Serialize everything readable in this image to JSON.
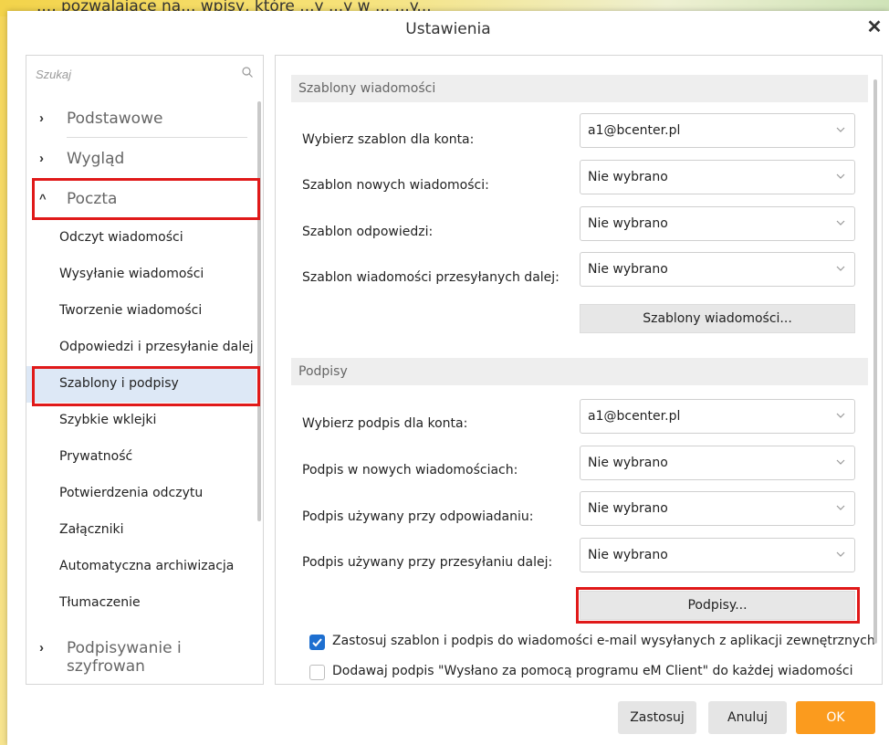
{
  "background": {
    "partial_text": "..., pozwalające na... wpisy, które ...y ...y w ... ...y..."
  },
  "dialog": {
    "title": "Ustawienia"
  },
  "sidebar": {
    "search_placeholder": "Szukaj",
    "categories": [
      {
        "label": "Podstawowe",
        "expanded": false
      },
      {
        "label": "Wygląd",
        "expanded": false
      },
      {
        "label": "Poczta",
        "expanded": true
      }
    ],
    "mail_items": [
      "Odczyt wiadomości",
      "Wysyłanie wiadomości",
      "Tworzenie wiadomości",
      "Odpowiedzi i przesyłanie dalej",
      "Szablony i podpisy",
      "Szybkie wklejki",
      "Prywatność",
      "Potwierdzenia odczytu",
      "Załączniki",
      "Automatyczna archiwizacja",
      "Tłumaczenie"
    ],
    "active_item": "Szablony i podpisy",
    "last_category": "Podpisywanie i szyfrowan"
  },
  "templates": {
    "heading": "Szablony wiadomości",
    "rows": [
      {
        "label": "Wybierz szablon dla konta:",
        "value": "a1@bcenter.pl"
      },
      {
        "label": "Szablon nowych wiadomości:",
        "value": "Nie wybrano"
      },
      {
        "label": "Szablon odpowiedzi:",
        "value": "Nie wybrano"
      },
      {
        "label": "Szablon wiadomości przesyłanych dalej:",
        "value": "Nie wybrano"
      }
    ],
    "button": "Szablony wiadomości..."
  },
  "signatures": {
    "heading": "Podpisy",
    "rows": [
      {
        "label": "Wybierz podpis dla konta:",
        "value": "a1@bcenter.pl"
      },
      {
        "label": "Podpis w nowych wiadomościach:",
        "value": "Nie wybrano"
      },
      {
        "label": "Podpis używany przy odpowiadaniu:",
        "value": "Nie wybrano"
      },
      {
        "label": "Podpis używany przy przesyłaniu dalej:",
        "value": "Nie wybrano"
      }
    ],
    "button": "Podpisy..."
  },
  "options": [
    {
      "label": "Zastosuj szablon i podpis do wiadomości e-mail wysyłanych z aplikacji zewnętrznych",
      "checked": true
    },
    {
      "label": "Dodawaj podpis \"Wysłano za pomocą programu eM Client\" do każdej wiadomości",
      "checked": false
    }
  ],
  "footer": {
    "apply": "Zastosuj",
    "cancel": "Anuluj",
    "ok": "OK"
  },
  "colors": {
    "accent_orange": "#fb9b1e",
    "highlight_red": "#e01919",
    "checkbox_blue": "#1e6fd0",
    "active_item_bg": "#dde8f6"
  }
}
